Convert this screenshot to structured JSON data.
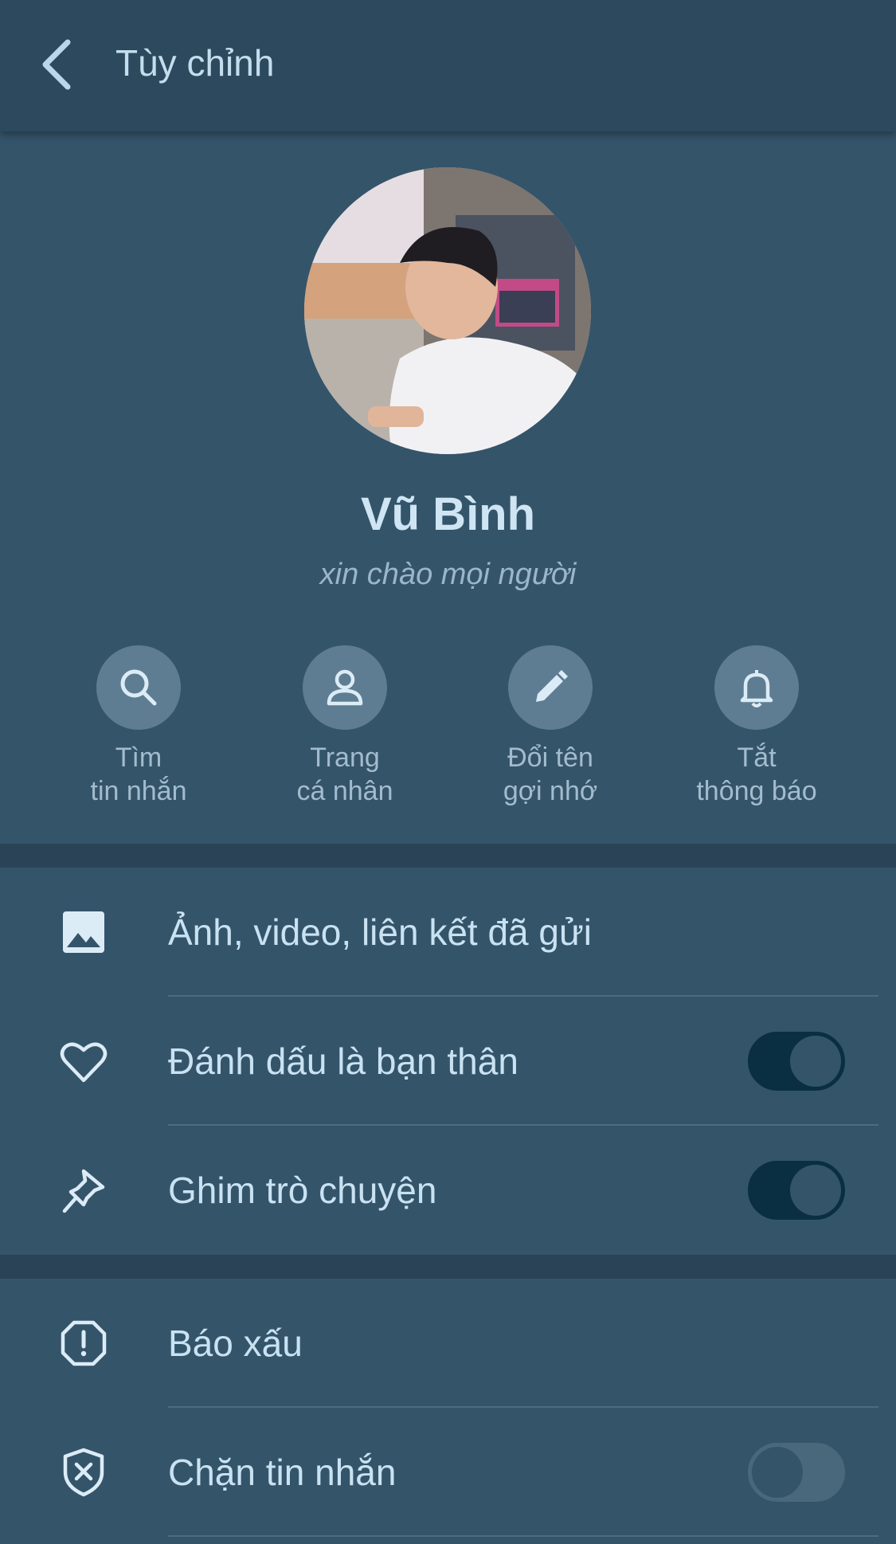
{
  "header": {
    "title": "Tùy chỉnh",
    "back_icon": "chevron-left-icon"
  },
  "profile": {
    "name": "Vũ Bình",
    "status": "xin chào mọi người"
  },
  "actions": [
    {
      "icon": "search-icon",
      "label": "Tìm\ntin nhắn"
    },
    {
      "icon": "user-icon",
      "label": "Trang\ncá nhân"
    },
    {
      "icon": "pencil-icon",
      "label": "Đổi tên\ngợi nhớ"
    },
    {
      "icon": "bell-icon",
      "label": "Tắt\nthông báo"
    }
  ],
  "section1": [
    {
      "icon": "image-icon",
      "label": "Ảnh, video, liên kết đã gửi"
    },
    {
      "icon": "heart-icon",
      "label": "Đánh dấu là bạn thân",
      "toggle": true
    },
    {
      "icon": "pin-icon",
      "label": "Ghim trò chuyện",
      "toggle": true
    }
  ],
  "section2": [
    {
      "icon": "report-icon",
      "label": "Báo xấu"
    },
    {
      "icon": "block-shield-icon",
      "label": "Chặn tin nhắn",
      "toggle": false
    }
  ],
  "colors": {
    "background": "#34546a",
    "header": "#2d495e",
    "toggle_on": "#0a2f43",
    "text": "#c9e2f2"
  }
}
